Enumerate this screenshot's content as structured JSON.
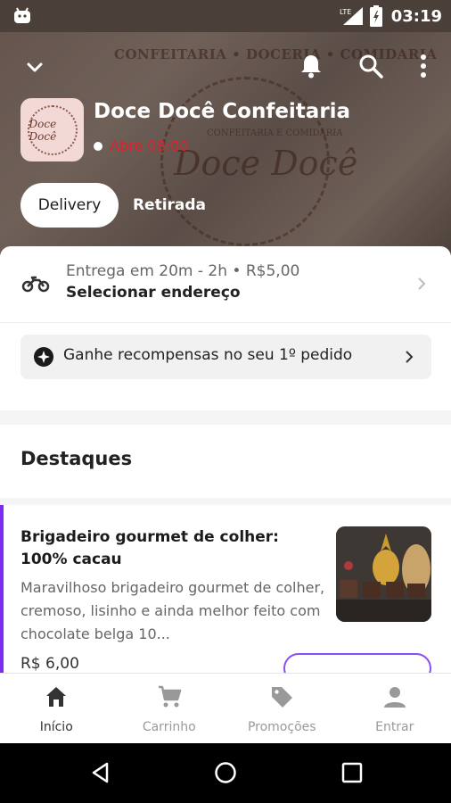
{
  "status_bar": {
    "network": "LTE",
    "time": "03:19"
  },
  "hero": {
    "watermark_top": "CONFEITARIA • DOCERIA • COMIDARIA",
    "watermark_sub": "CONFEITARIA E COMIDARIA",
    "watermark_big": "Doce Docê",
    "logo_text": "Doce Docê",
    "store_name": "Doce Docê Confeitaria",
    "open_status": "Abre 08:00",
    "tabs": [
      {
        "label": "Delivery",
        "active": true
      },
      {
        "label": "Retirada",
        "active": false
      }
    ]
  },
  "delivery": {
    "eta": "Entrega em 20m - 2h • R$5,00",
    "address_cta": "Selecionar endereço"
  },
  "rewards": {
    "label": "Ganhe recompensas no seu 1º pedido"
  },
  "section": {
    "title": "Destaques"
  },
  "item": {
    "title": "Brigadeiro gourmet de colher: 100% cacau",
    "description": "Maravilhoso brigadeiro gourmet de colher, cremoso, lisinho e ainda melhor feito com chocolate belga 10...",
    "price": "R$ 6,00",
    "tag": ""
  },
  "bottom_nav": [
    {
      "label": "Início",
      "icon": "home-icon",
      "active": true
    },
    {
      "label": "Carrinho",
      "icon": "cart-icon",
      "active": false
    },
    {
      "label": "Promoções",
      "icon": "tag-icon",
      "active": false
    },
    {
      "label": "Entrar",
      "icon": "person-icon",
      "active": false
    }
  ],
  "colors": {
    "accent": "#7b2cf5",
    "closed_red": "#e0202e"
  }
}
